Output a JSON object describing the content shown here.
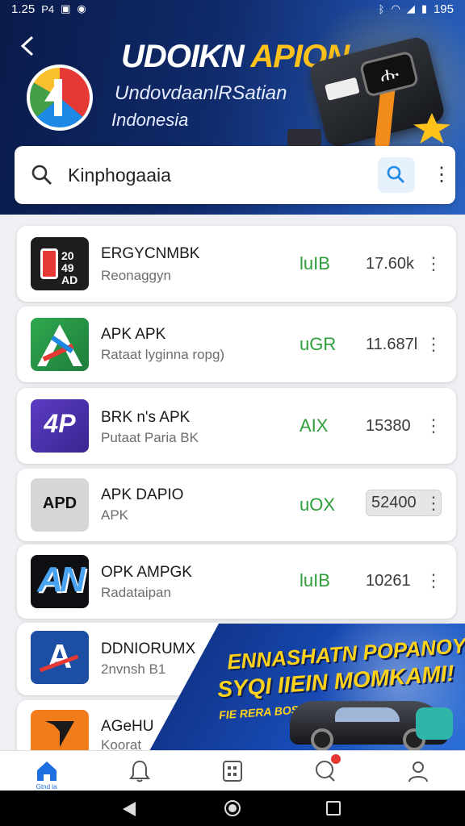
{
  "status_bar": {
    "time": "1.25",
    "left_icons": [
      "P4",
      "notification-icon",
      "image-icon",
      "compass-icon"
    ],
    "right_text": "195",
    "right_icons": [
      "bluetooth-icon",
      "wifi-icon",
      "signal-icon",
      "battery-icon"
    ]
  },
  "header": {
    "title_white": "UDOIKN",
    "title_yellow": "APION",
    "subtitle1": "UndovdaanlRSatian",
    "subtitle2": "Indonesia",
    "device_screen": "ሑ"
  },
  "search": {
    "value": "Kinphogaaia",
    "placeholder": "Kinphogaaia"
  },
  "apps": [
    {
      "name": "ERGYCNMBK",
      "sub": "Reonaggyn",
      "tag": "luIB",
      "count": "17.60k",
      "icon_text": "20\n49\nAD"
    },
    {
      "name": "APK  APK",
      "sub": "Rataat lyginna ropg)",
      "tag": "uGR",
      "count": "11.687l",
      "icon_text": ""
    },
    {
      "name": "BRK n's APK",
      "sub": "Putaat Paria BK",
      "tag": "AIX",
      "count": "15380",
      "icon_text": "4P"
    },
    {
      "name": "APK DAPIO",
      "sub": "APK",
      "tag": "uOX",
      "count": "52400",
      "icon_text": "APD"
    },
    {
      "name": "OPK AMPGK",
      "sub": "Radataipan",
      "tag": "luIB",
      "count": "10261",
      "icon_text": "AN"
    },
    {
      "name": "DDNIORUMX",
      "sub": "2nvnsh B1",
      "tag": "",
      "count": "",
      "icon_text": "A"
    },
    {
      "name": "AGeHU",
      "sub": "Koorat",
      "tag": "",
      "count": "",
      "icon_text": ""
    }
  ],
  "promo": {
    "line1": "ENNASHATN POPANOY!",
    "line2": "SYQI IIEIN MOMKAMI!",
    "line3": "FIE RERA BOSMHAIIAN"
  },
  "bottom_nav": {
    "items": [
      "home-icon",
      "bell-icon",
      "grid-icon",
      "chat-icon",
      "profile-icon"
    ],
    "home_caption": "Gtnd la"
  },
  "colors": {
    "accent": "#1e6fe0",
    "tag_green": "#2e9e3a",
    "promo_yellow": "#ffd21a",
    "header_dark": "#0a1b4a"
  }
}
